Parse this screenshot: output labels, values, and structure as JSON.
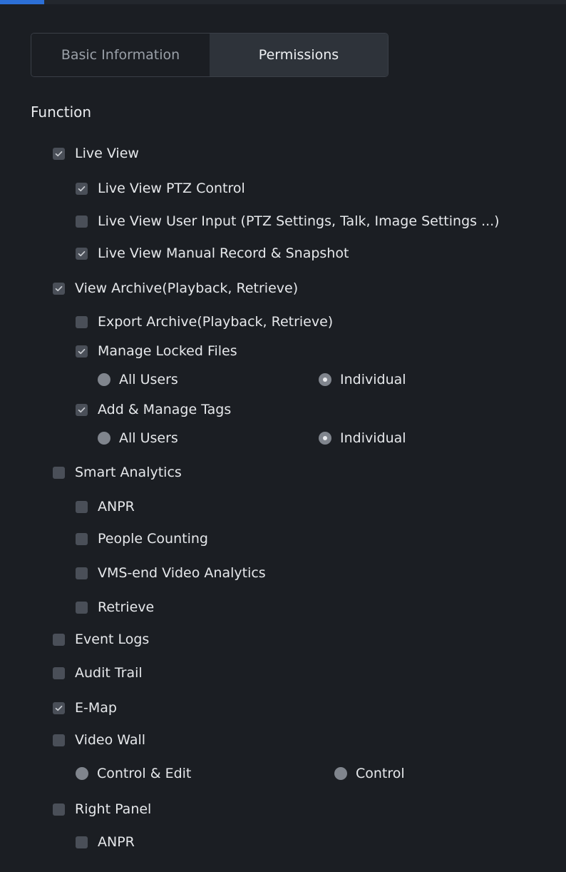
{
  "tabs": {
    "basic": "Basic Information",
    "permissions": "Permissions",
    "active": "permissions"
  },
  "section_title": "Function",
  "items": {
    "live_view": {
      "label": "Live View",
      "checked": true
    },
    "live_view_ptz": {
      "label": "Live View PTZ Control",
      "checked": true
    },
    "live_view_user_input": {
      "label": "Live View User Input (PTZ Settings, Talk, Image Settings ...)",
      "checked": false
    },
    "live_view_manual_record": {
      "label": "Live View Manual Record & Snapshot",
      "checked": true
    },
    "view_archive": {
      "label": "View Archive(Playback, Retrieve)",
      "checked": true
    },
    "export_archive": {
      "label": "Export Archive(Playback, Retrieve)",
      "checked": false
    },
    "manage_locked_files": {
      "label": "Manage Locked Files",
      "checked": true
    },
    "locked_files_all_users": {
      "label": "All Users",
      "checked": false
    },
    "locked_files_individual": {
      "label": "Individual",
      "checked": true
    },
    "add_manage_tags": {
      "label": "Add & Manage Tags",
      "checked": true
    },
    "tags_all_users": {
      "label": "All Users",
      "checked": false
    },
    "tags_individual": {
      "label": "Individual",
      "checked": true
    },
    "smart_analytics": {
      "label": "Smart Analytics",
      "checked": false
    },
    "anpr": {
      "label": "ANPR",
      "checked": false
    },
    "people_counting": {
      "label": "People Counting",
      "checked": false
    },
    "vms_video_analytics": {
      "label": "VMS-end Video Analytics",
      "checked": false
    },
    "retrieve": {
      "label": "Retrieve",
      "checked": false
    },
    "event_logs": {
      "label": "Event Logs",
      "checked": false
    },
    "audit_trail": {
      "label": "Audit Trail",
      "checked": false
    },
    "e_map": {
      "label": "E-Map",
      "checked": true
    },
    "video_wall": {
      "label": "Video Wall",
      "checked": false
    },
    "video_wall_control_edit": {
      "label": "Control & Edit",
      "checked": false
    },
    "video_wall_control": {
      "label": "Control",
      "checked": false
    },
    "right_panel": {
      "label": "Right Panel",
      "checked": false
    },
    "right_panel_anpr": {
      "label": "ANPR",
      "checked": false
    }
  },
  "colors": {
    "background": "#1b1e23",
    "accent": "#2c6fd6",
    "control_fill": "#4a4f58"
  }
}
